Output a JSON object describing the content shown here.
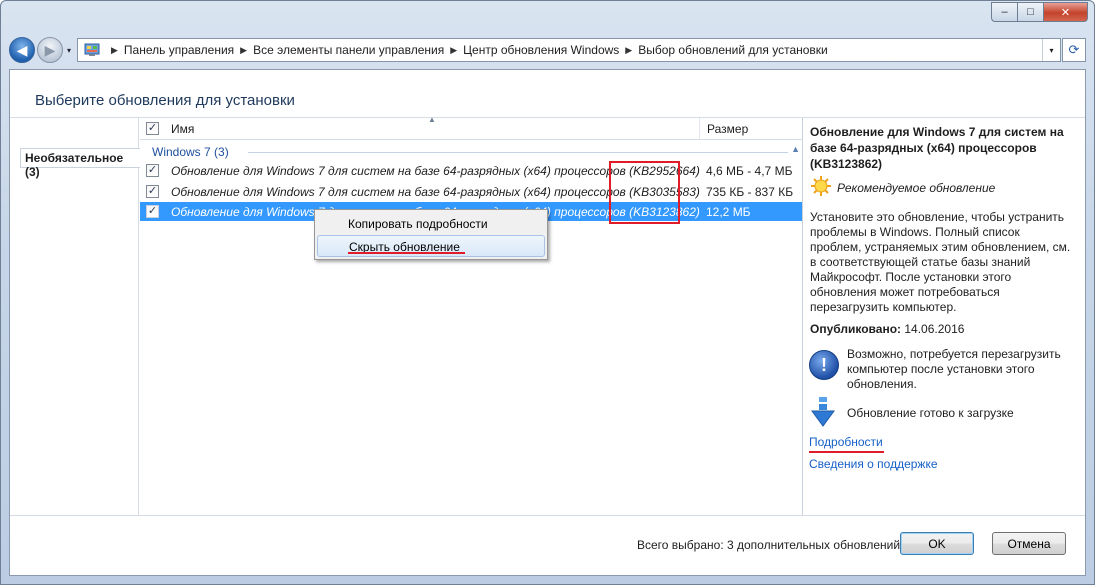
{
  "window": {
    "minimize": "–",
    "maximize": "□",
    "close": "✕"
  },
  "nav": {
    "back_arrow": "◀",
    "forward_arrow": "▶",
    "history_dropdown": "▾",
    "address_dropdown": "▾",
    "refresh": "⟳",
    "breadcrumbs": [
      "Панель управления",
      "Все элементы панели управления",
      "Центр обновления Windows",
      "Выбор обновлений для установки"
    ],
    "breadcrumb_separator": "▶"
  },
  "page": {
    "title": "Выберите обновления для установки"
  },
  "sidebar": {
    "category": "Необязательное (3)"
  },
  "list": {
    "header_check": "✓",
    "column_name": "Имя",
    "column_size": "Размер",
    "sort_indicator": "▲",
    "group": "Windows 7 (3)",
    "group_toggle": "▲",
    "rows": [
      {
        "checked": "✓",
        "name": "Обновление для Windows 7 для систем на базе 64-разрядных (x64) процессоров (KB2952664)",
        "size": "4,6 МБ - 4,7 МБ"
      },
      {
        "checked": "✓",
        "name": "Обновление для Windows 7 для систем на базе 64-разрядных (x64) процессоров (KB3035583)",
        "size": "735 КБ - 837 КБ"
      },
      {
        "checked": "✓",
        "name": "Обновление для Windows 7 для систем на базе 64-разрядных (x64) процессоров (KB3123862)",
        "size": "12,2 МБ"
      }
    ]
  },
  "context_menu": {
    "items": [
      "Копировать подробности",
      "Скрыть обновление"
    ]
  },
  "details": {
    "title": "Обновление для Windows 7 для систем на базе 64-разрядных (x64) процессоров (KB3123862)",
    "recommended": "Рекомендуемое обновление",
    "description": "Установите это обновление, чтобы устранить проблемы в Windows. Полный список проблем, устраняемых этим обновлением, см. в соответствующей статье базы знаний Майкрософт. После установки этого обновления может потребоваться перезагрузить компьютер.",
    "published_label": "Опубликовано:",
    "published_date": "14.06.2016",
    "restart_note": "Возможно, потребуется перезагрузить компьютер после установки этого обновления.",
    "download_status": "Обновление готово к загрузке",
    "link_details": "Подробности",
    "link_support": "Сведения о поддержке"
  },
  "footer": {
    "total": "Всего выбрано: 3 дополнительных обновлений",
    "ok": "OK",
    "cancel": "Отмена"
  },
  "colors": {
    "accent": "#3399ff",
    "highlight_red": "#e01c28",
    "link": "#1560c7",
    "title": "#1e395b"
  }
}
